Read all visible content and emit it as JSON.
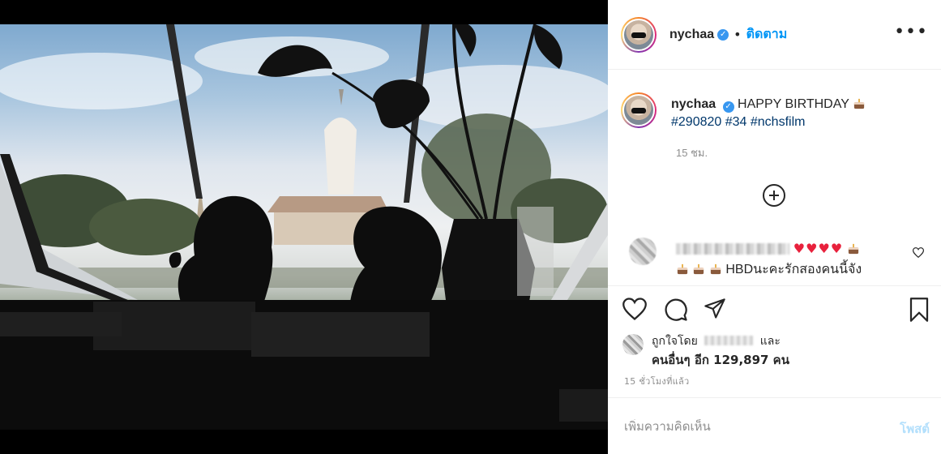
{
  "post": {
    "username": "nychaa",
    "verified_glyph": "✓",
    "separator": "•",
    "follow_label": "ติดตาม",
    "more_label": "•••"
  },
  "caption": {
    "username": "nychaa",
    "text": "HAPPY BIRTHDAY",
    "hashtags": "#290820 #34 #nchsfilm",
    "time": "15 ชม."
  },
  "comment": {
    "line2_text": "HBDนะคะรักสองคนนี้จัง"
  },
  "likes": {
    "liked_by": "ถูกใจโดย",
    "and": "และ",
    "others": "คนอื่นๆ อีก 129,897 คน"
  },
  "timestamp": "15 ชั่วโมงที่แล้ว",
  "comment_box": {
    "placeholder": "เพิ่มความคิดเห็น",
    "post_label": "โพสต์"
  },
  "icons": {
    "verified": "verified-badge-icon",
    "more": "more-options-icon",
    "add": "add-circle-icon",
    "like": "heart-icon",
    "comment": "comment-icon",
    "share": "paper-plane-icon",
    "save": "bookmark-icon"
  },
  "colors": {
    "link_blue": "#0095f6",
    "hashtag": "#00376b",
    "heart_red": "#e8213c",
    "post_disabled": "#b2dffc"
  }
}
